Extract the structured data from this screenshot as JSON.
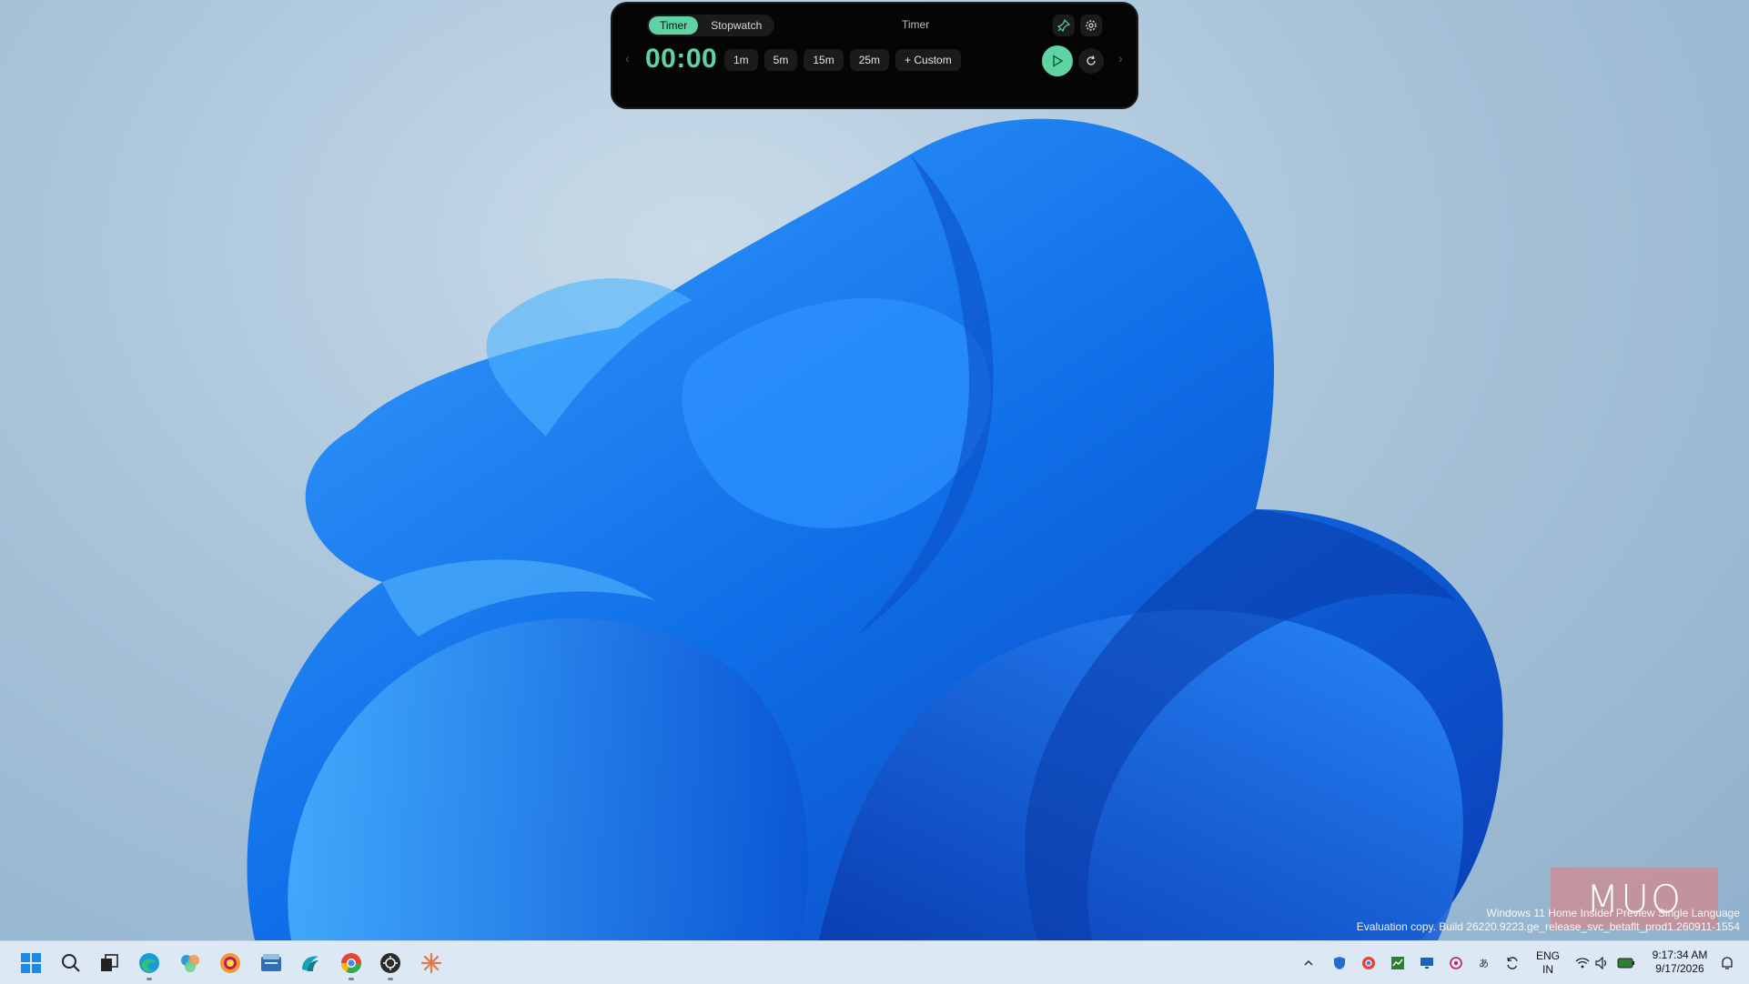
{
  "widget": {
    "tabs": [
      "Timer",
      "Stopwatch"
    ],
    "active_tab": "Timer",
    "title": "Timer",
    "time": "00:00",
    "presets": [
      "1m",
      "5m",
      "15m",
      "25m"
    ],
    "custom_label": "Custom",
    "icons": [
      "pin-icon",
      "settings-icon",
      "play-icon",
      "reset-icon",
      "chevron-left-icon",
      "chevron-right-icon"
    ],
    "accent": "#5fd3a4"
  },
  "watermark": {
    "line1": "Windows 11 Home Insider Preview Single Language",
    "line2": "Evaluation copy. Build 26220.9223.ge_release_svc_betaflt_prod1.260911-1554",
    "logo": "MUO"
  },
  "taskbar": {
    "apps": [
      "start-icon",
      "search-icon",
      "task-view-icon",
      "edge-icon",
      "photos-icon",
      "edge-canary-icon",
      "file-explorer-icon",
      "copilot-icon",
      "chrome-icon",
      "app-icon",
      "claude-icon"
    ],
    "language_line1": "ENG",
    "language_line2": "IN",
    "time": "9:17:34 AM",
    "date": "9/17/2026"
  }
}
